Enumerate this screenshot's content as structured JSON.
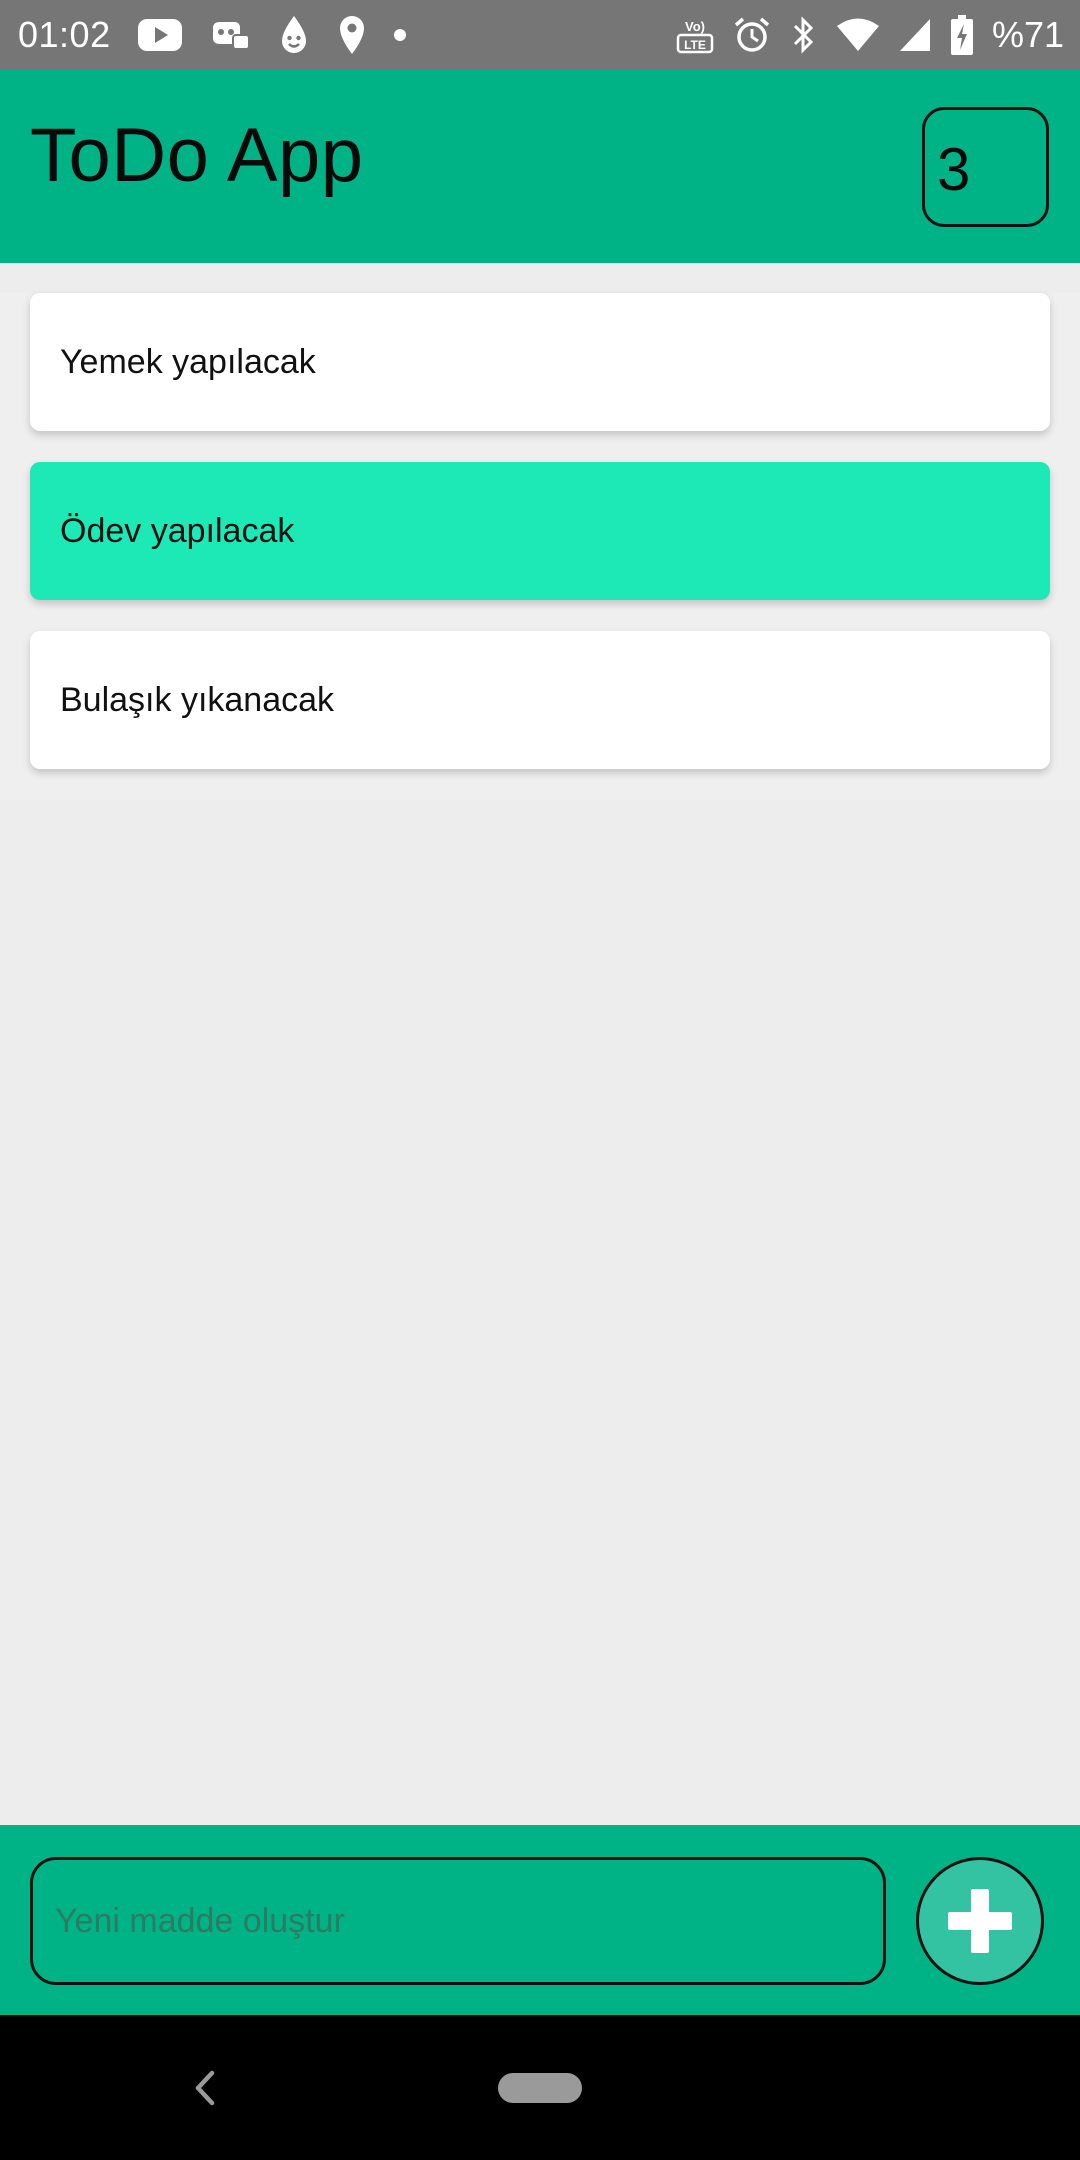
{
  "status_bar": {
    "time": "01:02",
    "battery": "%71",
    "icons": [
      "youtube-icon",
      "game-controller-icon",
      "drop-icon",
      "location-pin-icon",
      "notification-dot-icon",
      "volte-icon",
      "alarm-icon",
      "bluetooth-icon",
      "wifi-icon",
      "signal-icon",
      "battery-charging-icon"
    ]
  },
  "app_bar": {
    "title": "ToDo App",
    "count": "3"
  },
  "todos": [
    {
      "text": "Yemek yapılacak",
      "done": false
    },
    {
      "text": "Ödev yapılacak",
      "done": true
    },
    {
      "text": "Bulaşık yıkanacak",
      "done": false
    }
  ],
  "input": {
    "placeholder": "Yeni madde oluştur",
    "value": ""
  },
  "add_button_icon": "plus-icon",
  "colors": {
    "primary": "#00b386",
    "done_item": "#1de9b6",
    "add_button": "#33c3a3",
    "status_bar": "#767676",
    "background": "#ededed"
  }
}
